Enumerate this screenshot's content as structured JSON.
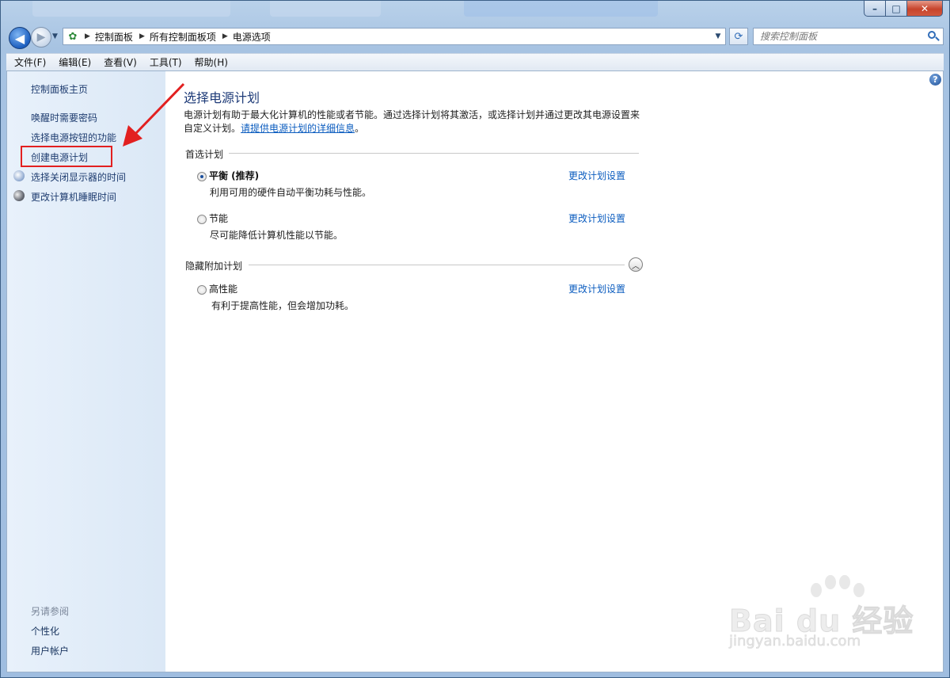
{
  "window": {
    "controls": {
      "minimize": "–",
      "maximize": "□",
      "close": "✕"
    }
  },
  "nav": {
    "back_icon": "back-arrow-icon",
    "forward_icon": "forward-arrow-icon",
    "breadcrumbs": [
      "控制面板",
      "所有控制面板项",
      "电源选项"
    ],
    "search_placeholder": "搜索控制面板"
  },
  "menu": [
    "文件(F)",
    "编辑(E)",
    "查看(V)",
    "工具(T)",
    "帮助(H)"
  ],
  "sidebar": {
    "home": "控制面板主页",
    "links": [
      "唤醒时需要密码",
      "选择电源按钮的功能",
      "创建电源计划",
      "选择关闭显示器的时间",
      "更改计算机睡眠时间"
    ],
    "see_also_label": "另请参阅",
    "see_also": [
      "个性化",
      "用户帐户"
    ]
  },
  "main": {
    "title": "选择电源计划",
    "description": "电源计划有助于最大化计算机的性能或者节能。通过选择计划将其激活，或选择计划并通过更改其电源设置来自定义计划。",
    "description_link": "请提供电源计划的详细信息",
    "description_end": "。",
    "preferred_group": "首选计划",
    "hidden_group": "隐藏附加计划",
    "change_link": "更改计划设置",
    "plans": [
      {
        "name": "平衡 (推荐)",
        "desc": "利用可用的硬件自动平衡功耗与性能。",
        "selected": true
      },
      {
        "name": "节能",
        "desc": "尽可能降低计算机性能以节能。",
        "selected": false
      },
      {
        "name": "高性能",
        "desc": "有利于提高性能，但会增加功耗。",
        "selected": false
      }
    ]
  },
  "watermark": {
    "brand": "Bai du 经验",
    "url": "jingyan.baidu.com"
  },
  "colors": {
    "annotation": "#e22020",
    "link": "#0b5cbf",
    "title": "#1e3b78"
  }
}
